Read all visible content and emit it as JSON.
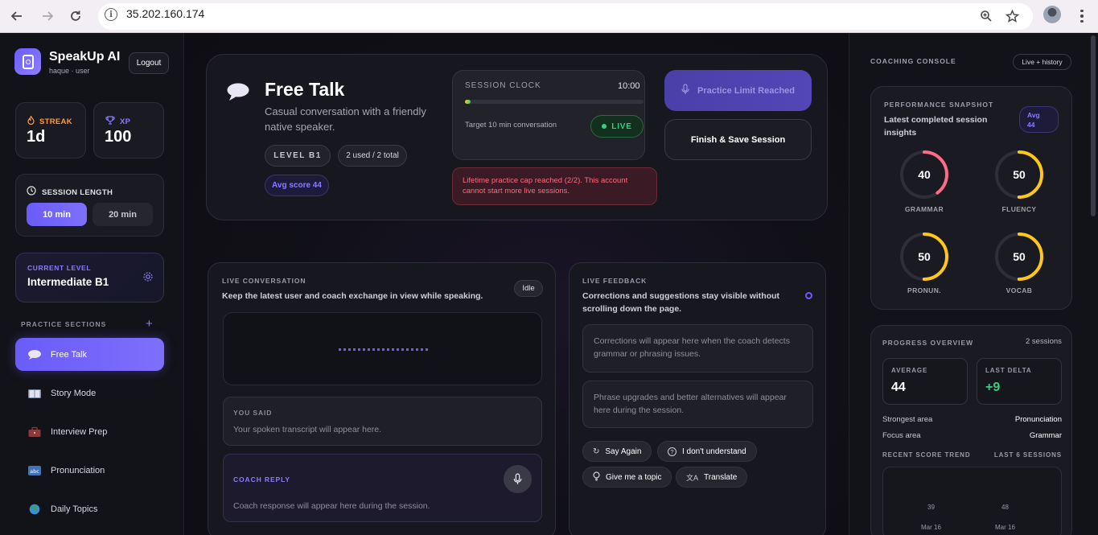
{
  "browser": {
    "url": "35.202.160.174"
  },
  "sidebar": {
    "brand": "SpeakUp AI",
    "user": "haque · user",
    "logout_label": "Logout",
    "streak": {
      "label": "STREAK",
      "value": "1d",
      "color": "#ff9a3c"
    },
    "xp": {
      "label": "XP",
      "value": "100",
      "color": "#8a7cff"
    },
    "session_length": {
      "label": "SESSION LENGTH",
      "options": [
        "10 min",
        "20 min"
      ],
      "selected": "10 min"
    },
    "current_level": {
      "label": "CURRENT LEVEL",
      "value": "Intermediate B1"
    },
    "practice_sections_label": "PRACTICE SECTIONS",
    "sections": [
      {
        "label": "Free Talk",
        "icon": "speech-bubble-icon",
        "active": true
      },
      {
        "label": "Story Mode",
        "icon": "book-icon",
        "active": false
      },
      {
        "label": "Interview Prep",
        "icon": "briefcase-icon",
        "active": false
      },
      {
        "label": "Pronunciation",
        "icon": "abc-icon",
        "active": false
      },
      {
        "label": "Daily Topics",
        "icon": "globe-icon",
        "active": false
      }
    ]
  },
  "header": {
    "title": "Free Talk",
    "subtitle": "Casual conversation with a friendly native speaker.",
    "level_badge": "LEVEL B1",
    "usage_badge": "2 used / 2 total",
    "avg_badge": "Avg score 44",
    "session_clock": {
      "label": "SESSION CLOCK",
      "time": "10:00",
      "target": "Target 10 min conversation",
      "status": "LIVE",
      "progress": 0.03
    },
    "limit_button": "Practice Limit Reached",
    "finish_button": "Finish & Save Session",
    "warning": "Lifetime practice cap reached (2/2). This account cannot start more live sessions."
  },
  "conversation": {
    "label": "LIVE CONVERSATION",
    "desc": "Keep the latest user and coach exchange in view while speaking.",
    "status": "Idle",
    "you_said_label": "YOU SAID",
    "you_said_text": "Your spoken transcript will appear here.",
    "coach_label": "COACH REPLY",
    "coach_text": "Coach response will appear here during the session."
  },
  "feedback": {
    "label": "LIVE FEEDBACK",
    "desc": "Corrections and suggestions stay visible without scrolling down the page.",
    "corrections_text": "Corrections will appear here when the coach detects grammar or phrasing issues.",
    "phrases_text": "Phrase upgrades and better alternatives will appear here during the session.",
    "quick_actions": [
      {
        "label": "Say Again",
        "icon": "repeat-icon"
      },
      {
        "label": "I don't understand",
        "icon": "question-icon"
      },
      {
        "label": "Give me a topic",
        "icon": "lightbulb-icon"
      },
      {
        "label": "Translate",
        "icon": "translate-icon"
      }
    ]
  },
  "console": {
    "label": "COACHING CONSOLE",
    "toggle_label": "Live + history",
    "snapshot": {
      "label": "PERFORMANCE SNAPSHOT",
      "desc": "Latest completed session insights",
      "avg_badge": "Avg 44",
      "scores": [
        {
          "name": "GRAMMAR",
          "value": 40,
          "color": "#ff6b86"
        },
        {
          "name": "FLUENCY",
          "value": 50,
          "color": "#ffc71a"
        },
        {
          "name": "PRONUN.",
          "value": 50,
          "color": "#ffc71a"
        },
        {
          "name": "VOCAB",
          "value": 50,
          "color": "#ffc71a"
        }
      ]
    },
    "progress": {
      "label": "PROGRESS OVERVIEW",
      "sessions": "2 sessions",
      "average_label": "AVERAGE",
      "average_value": "44",
      "delta_label": "LAST DELTA",
      "delta_value": "+9",
      "strongest_label": "Strongest area",
      "strongest_value": "Pronunciation",
      "focus_label": "Focus area",
      "focus_value": "Grammar",
      "trend_label": "RECENT SCORE TREND",
      "trend_range": "LAST 6 SESSIONS",
      "trend": [
        {
          "value": "39",
          "date": "Mar 16"
        },
        {
          "value": "48",
          "date": "Mar 16"
        }
      ]
    }
  },
  "colors": {
    "accent": "#6b5cff",
    "live_green": "#35d07f",
    "warning_red": "#ff6b7d"
  }
}
